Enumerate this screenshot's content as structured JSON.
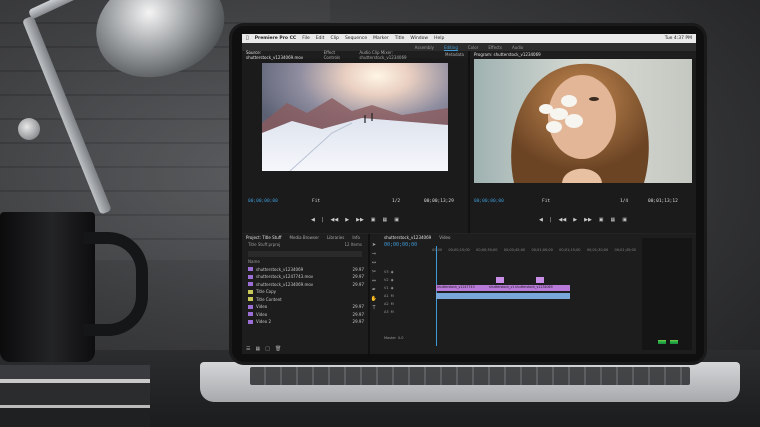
{
  "menubar": {
    "app_name": "Premiere Pro CC",
    "items": [
      "File",
      "Edit",
      "Clip",
      "Sequence",
      "Marker",
      "Title",
      "Window",
      "Help"
    ],
    "clock": "Tue 4:37 PM"
  },
  "workspaces": {
    "items": [
      "Assembly",
      "Editing",
      "Color",
      "Effects",
      "Audio"
    ],
    "active": "Editing"
  },
  "source_monitor": {
    "tabs": [
      "Source: shutterstock_v1234069.mov",
      "Effect Controls",
      "Audio Clip Mixer: shutterstock_v1234069",
      "Metadata"
    ],
    "timecode_in": "00;00;00;00",
    "timecode_out": "00;00;13;29",
    "fit": "Fit",
    "scale": "1/2"
  },
  "program_monitor": {
    "tabs": [
      "Program: shutterstock_v1234069"
    ],
    "timecode_in": "00;00;00;00",
    "timecode_out": "00;01;13;12",
    "fit": "Fit",
    "scale": "1/4"
  },
  "project_panel": {
    "tabs": [
      "Project: Title Stuff",
      "Media Browser",
      "Libraries",
      "Info"
    ],
    "project_file": "Title Stuff.prproj",
    "item_count": "12 Items",
    "header": "Name",
    "items": [
      {
        "name": "shutterstock_v1234069",
        "rate": "29.97",
        "color": "#9b6fd6"
      },
      {
        "name": "shutterstock_v1247743.mov",
        "rate": "29.97",
        "color": "#9b6fd6"
      },
      {
        "name": "shutterstock_v1234069.mov",
        "rate": "29.97",
        "color": "#9b6fd6"
      },
      {
        "name": "Title Copy",
        "rate": "",
        "color": "#c9c95a"
      },
      {
        "name": "Title Content",
        "rate": "",
        "color": "#c9c95a"
      },
      {
        "name": "Video",
        "rate": "29.97",
        "color": "#9b6fd6"
      },
      {
        "name": "Video",
        "rate": "29.97",
        "color": "#9b6fd6"
      },
      {
        "name": "Video 2",
        "rate": "29.97",
        "color": "#9b6fd6"
      }
    ]
  },
  "timeline": {
    "tabs": [
      "shutterstock_v1234069",
      "Video"
    ],
    "timecode": "00;00;00;00",
    "ruler": [
      "00;00",
      "00;00;15;00",
      "00;00;30;00",
      "00;00;45;00",
      "00;01;00;00",
      "00;01;15;00",
      "00;01;30;00",
      "00;01;45;00"
    ],
    "tracks": [
      "V3",
      "V2",
      "V1",
      "A1",
      "A2",
      "A3",
      "Master"
    ],
    "master_value": "0.0",
    "clips_v1": [
      "shutterstock_v1247743",
      "shutterstock_v1247743",
      "shutterstock_v1234069"
    ]
  },
  "colors": {
    "accent": "#3f9bd6",
    "video_clip": "#b87ad9",
    "audio_clip": "#7aa7d9"
  }
}
